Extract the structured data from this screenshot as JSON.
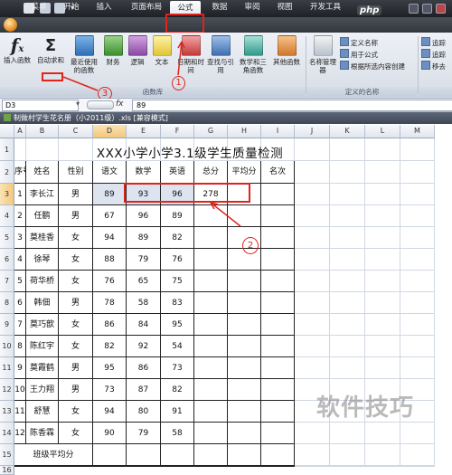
{
  "titlebar": {
    "icons": [
      "save-icon",
      "undo-icon",
      "redo-icon",
      "quick-access-dropdown-icon"
    ]
  },
  "tabs": [
    {
      "label": "菜单"
    },
    {
      "label": "开始"
    },
    {
      "label": "插入"
    },
    {
      "label": "页面布局"
    },
    {
      "label": "公式",
      "active": true
    },
    {
      "label": "数据"
    },
    {
      "label": "审阅"
    },
    {
      "label": "视图"
    },
    {
      "label": "开发工具"
    }
  ],
  "ribbon": {
    "buttons": [
      {
        "label": "插入函数",
        "icon": "insert-function-icon"
      },
      {
        "label": "自动求和",
        "icon": "autosum-icon"
      },
      {
        "label": "最近使用的函数",
        "icon": "recent-functions-icon"
      },
      {
        "label": "财务",
        "icon": "financial-icon"
      },
      {
        "label": "逻辑",
        "icon": "logical-icon"
      },
      {
        "label": "文本",
        "icon": "text-icon"
      },
      {
        "label": "日期和时间",
        "icon": "date-time-icon"
      },
      {
        "label": "查找与引用",
        "icon": "lookup-icon"
      },
      {
        "label": "数学和三角函数",
        "icon": "math-icon"
      },
      {
        "label": "其他函数",
        "icon": "more-functions-icon"
      },
      {
        "label": "名称管理器",
        "icon": "name-manager-icon"
      }
    ],
    "group_labels": {
      "function_library": "函数库",
      "defined_names": "定义的名称"
    },
    "defined_names_items": [
      "定义名称",
      "用于公式",
      "根据所选内容创建"
    ],
    "partial_items": [
      "追踪",
      "追踪",
      "移去"
    ],
    "colors": {
      "accent": "#e0241c",
      "ribbon": "#dfe4ec"
    }
  },
  "formula_bar": {
    "name_box": "D3",
    "fx": "fx",
    "formula": "89"
  },
  "workbook": {
    "title": "制做村学生花名册（小2011级）.xls  [兼容模式]"
  },
  "sheet": {
    "columns": [
      "A",
      "B",
      "C",
      "D",
      "E",
      "F",
      "G",
      "H",
      "I",
      "J",
      "K",
      "L",
      "M"
    ],
    "title": "XXX小学小学3.1级学生质量检测",
    "headers": [
      "序号",
      "姓名",
      "性别",
      "语文",
      "数学",
      "英语",
      "总分",
      "平均分",
      "名次"
    ],
    "rows": [
      [
        "1",
        "李长江",
        "男",
        "89",
        "93",
        "96",
        "278",
        "",
        ""
      ],
      [
        "2",
        "任鹏",
        "男",
        "67",
        "96",
        "89",
        "",
        "",
        ""
      ],
      [
        "3",
        "莫桂香",
        "女",
        "94",
        "89",
        "82",
        "",
        "",
        ""
      ],
      [
        "4",
        "徐琴",
        "女",
        "88",
        "79",
        "76",
        "",
        "",
        ""
      ],
      [
        "5",
        "荷华桥",
        "女",
        "76",
        "65",
        "75",
        "",
        "",
        ""
      ],
      [
        "6",
        "韩佃",
        "男",
        "78",
        "58",
        "83",
        "",
        "",
        ""
      ],
      [
        "7",
        "莫巧歆",
        "女",
        "86",
        "84",
        "95",
        "",
        "",
        ""
      ],
      [
        "8",
        "陈红宇",
        "女",
        "82",
        "92",
        "54",
        "",
        "",
        ""
      ],
      [
        "9",
        "莫霞鹤",
        "男",
        "95",
        "86",
        "73",
        "",
        "",
        ""
      ],
      [
        "10",
        "王力翔",
        "男",
        "73",
        "87",
        "82",
        "",
        "",
        ""
      ],
      [
        "11",
        "舒慧",
        "女",
        "94",
        "80",
        "91",
        "",
        "",
        ""
      ],
      [
        "12",
        "陈香霖",
        "女",
        "90",
        "79",
        "58",
        "",
        "",
        ""
      ]
    ],
    "footer": "班级平均分",
    "row_numbers": [
      "1",
      "2",
      "3",
      "4",
      "5",
      "6",
      "7",
      "8",
      "9",
      "10",
      "11",
      "12",
      "13",
      "14",
      "15",
      "16"
    ]
  },
  "annotations": {
    "one": "1",
    "two": "2",
    "three": "3"
  },
  "watermark": {
    "text": "软件技巧",
    "site": "php"
  }
}
